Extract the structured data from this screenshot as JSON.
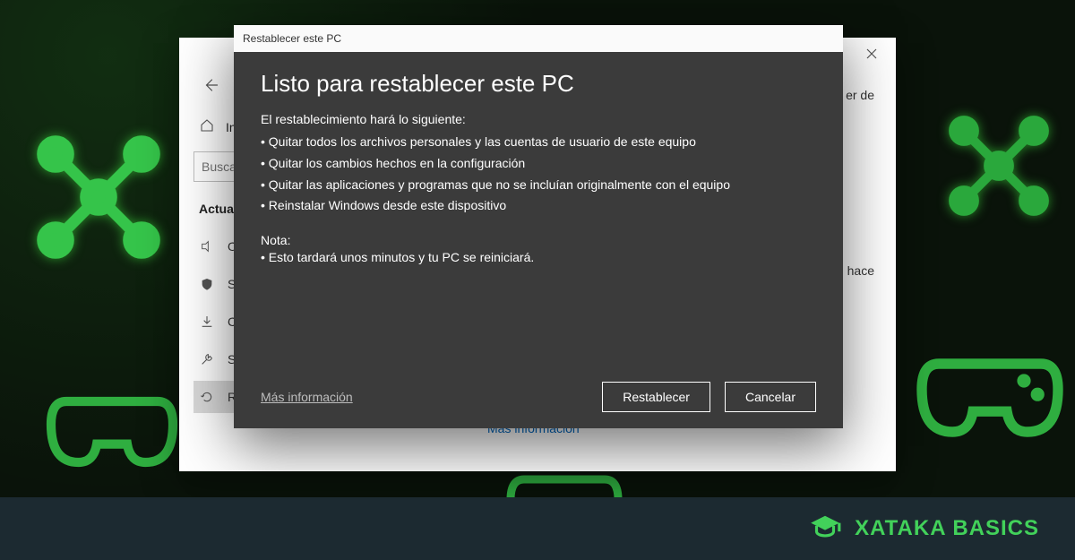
{
  "brand": {
    "text": "XATAKA BASICS"
  },
  "settings": {
    "home_label": "Inicio",
    "search_placeholder": "Buscar una opción",
    "section_head": "Actualización y seguridad",
    "nav": [
      {
        "label": "Optimización de distribución"
      },
      {
        "label": "Seguridad de Windows"
      },
      {
        "label": "Copia de seguridad"
      },
      {
        "label": "Solucionar problemas"
      },
      {
        "label": "Recuperación"
      }
    ],
    "main_fragment_right_1": "er de",
    "main_fragment_right_2": "hace",
    "more_info": "Más información"
  },
  "modal": {
    "window_title": "Restablecer este PC",
    "heading": "Listo para restablecer este PC",
    "lead": "El restablecimiento hará lo siguiente:",
    "bullets": [
      "Quitar todos los archivos personales y las cuentas de usuario de este equipo",
      "Quitar los cambios hechos en la configuración",
      " Quitar las aplicaciones y programas que no se incluían originalmente con el equipo",
      "Reinstalar Windows desde este dispositivo"
    ],
    "note_head": "Nota:",
    "note_bullets": [
      "Esto tardará unos minutos y tu PC se reiniciará."
    ],
    "more_info": "Más información",
    "primary": "Restablecer",
    "secondary": "Cancelar"
  }
}
